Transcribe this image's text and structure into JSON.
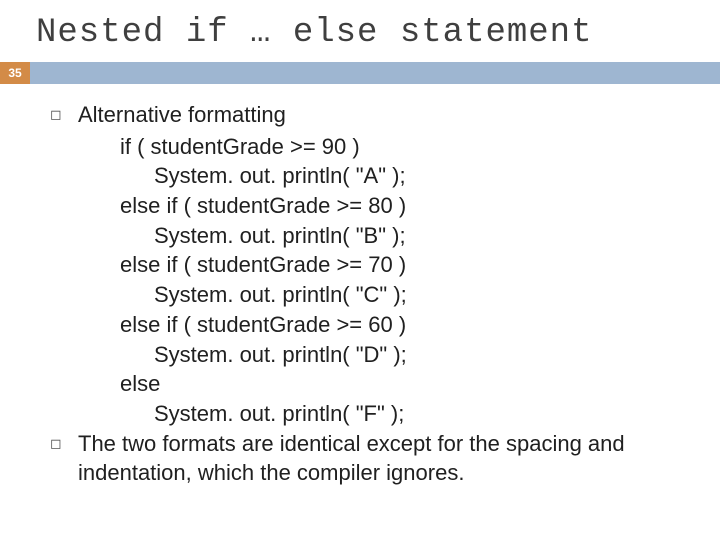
{
  "slide": {
    "title": "Nested if … else statement",
    "pagenum": "35",
    "bullet1": "Alternative formatting",
    "code": {
      "l1": "if ( studentGrade >= 90 )",
      "l2": "System. out. println( \"A\" );",
      "l3": "else if ( studentGrade >= 80 )",
      "l4": "System. out. println( \"B\" );",
      "l5": "else if ( studentGrade >= 70 )",
      "l6": "System. out. println( \"C\" );",
      "l7": "else if ( studentGrade >= 60 )",
      "l8": "System. out. println( \"D\" );",
      "l9": "else",
      "l10": "System. out. println( \"F\" );"
    },
    "bullet2": "The two formats are identical except for the spacing and indentation, which the compiler ignores."
  }
}
